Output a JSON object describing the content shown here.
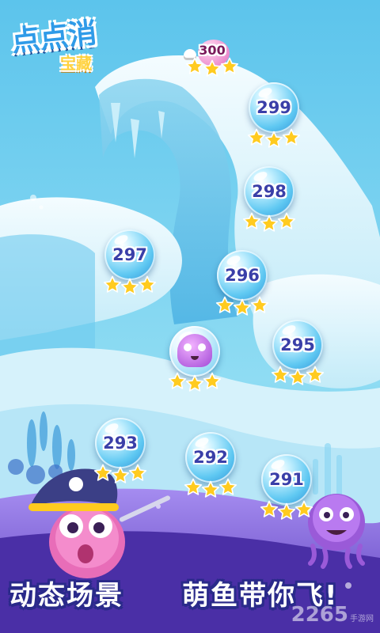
{
  "logo": {
    "title": "点点消",
    "subtitle": "宝藏",
    "title_color": "#2f9be8",
    "subtitle_color": "#ffd23f"
  },
  "levels": [
    {
      "number": "300",
      "stars": 3,
      "icon": "skull-icon",
      "style": "pink"
    },
    {
      "number": "299",
      "stars": 3
    },
    {
      "number": "298",
      "stars": 3
    },
    {
      "number": "297",
      "stars": 3
    },
    {
      "number": "296",
      "stars": 3
    },
    {
      "number": "295",
      "stars": 3
    },
    {
      "current_marker": "jellyfish-icon",
      "stars": 3
    },
    {
      "number": "293",
      "stars": 3
    },
    {
      "number": "292",
      "stars": 3
    },
    {
      "number": "291",
      "stars": 3
    }
  ],
  "captions": {
    "left": "动态场景",
    "right": "萌鱼带你飞!"
  },
  "watermark": {
    "brand": "2265",
    "label": "手游网"
  },
  "colors": {
    "sky": "#7fd3ef",
    "ice": "#e8f7fc",
    "level_number": "#3a3fa8",
    "star": "#ffcb1f",
    "purple_floor": "#7a5ad6"
  }
}
